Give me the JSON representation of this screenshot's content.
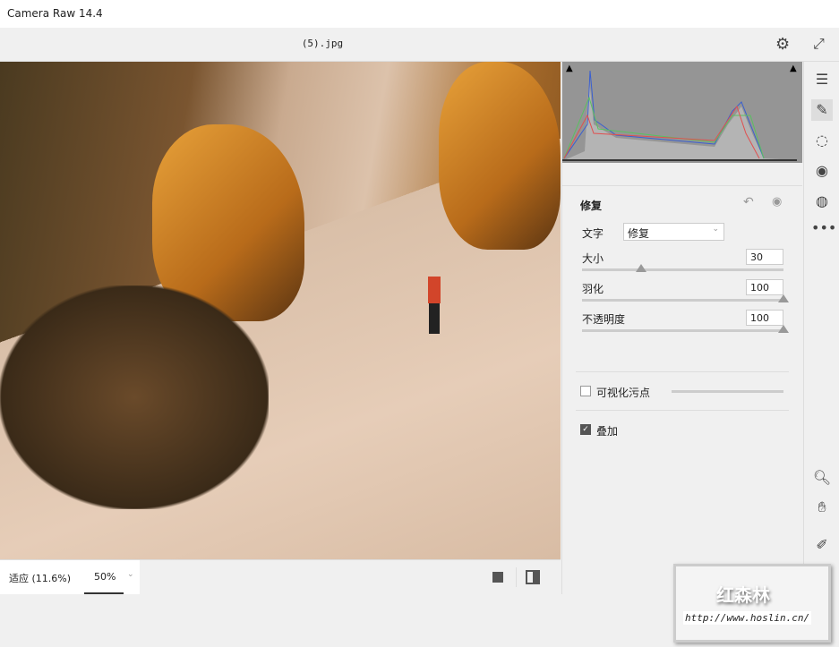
{
  "app": {
    "title": "Camera Raw 14.4"
  },
  "toolbar": {
    "filename": "(5).jpg"
  },
  "panel": {
    "title": "修复",
    "type_label": "文字",
    "type_value": "修复",
    "size_label": "大小",
    "size_value": "30",
    "size_fraction": 0.3,
    "feather_label": "羽化",
    "feather_value": "100",
    "opacity_label": "不透明度",
    "opacity_value": "100",
    "visualize_label": "可视化污点",
    "visualize_checked": false,
    "overlay_label": "叠加",
    "overlay_checked": true
  },
  "bottom": {
    "fit_label": "适应 (11.6%)",
    "zoom_value": "50%"
  },
  "watermark": {
    "brand": "红森林",
    "url": "http://www.hoslin.cn/"
  }
}
